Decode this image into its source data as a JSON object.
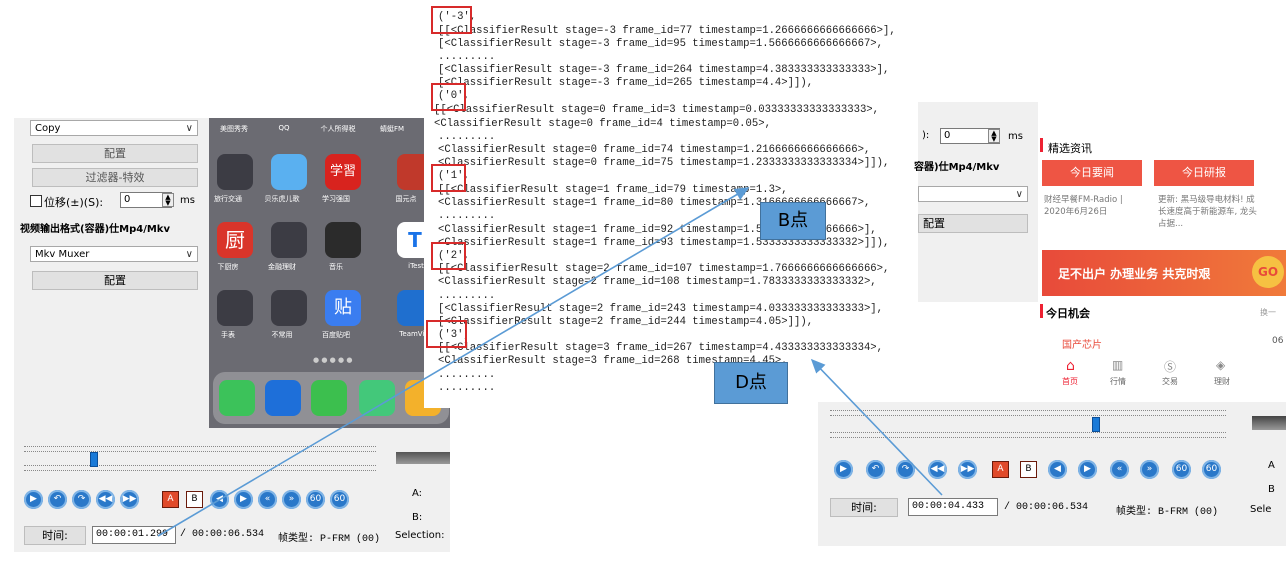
{
  "left_editor": {
    "mode_select": "Copy",
    "config_label": "配置",
    "filter_label": "过滤器-特效",
    "shift_label": "位移(±)(S):",
    "shift_value": "0",
    "shift_unit": "ms",
    "output_format_heading": "视频输出格式(容器)仕Mp4/Mkv",
    "muxer_select": "Mkv Muxer",
    "config2_label": "配置",
    "time_label": "时间:",
    "time_value": "00:00:01.299",
    "duration": "/ 00:00:06.534",
    "frame_type": "帧类型: P-FRM (00)",
    "a_label": "A:",
    "b_label": "B:",
    "selection_label": "Selection:"
  },
  "phone": {
    "top_labels": [
      "美图秀秀",
      "QQ",
      "个人所得税",
      "蜻蜓FM"
    ],
    "row1_labels": [
      "旅行交通",
      "贝乐虎儿歌",
      "学习强国",
      "国元点"
    ],
    "row2_labels": [
      "下厨房",
      "金融理财",
      "音乐",
      "iTest"
    ],
    "row3_labels": [
      "手表",
      "不常用",
      "百度贴吧",
      "TeamVie"
    ],
    "app_glyphs": {
      "xuexi": "学習",
      "xiachufang": "厨",
      "tieba": "贴",
      "itest": "T"
    }
  },
  "log": {
    "lines": [
      "('-3',",
      "[[<ClassifierResult stage=-3 frame_id=77 timestamp=1.2666666666666666>],",
      "[<ClassifierResult stage=-3 frame_id=95 timestamp=1.5666666666666667>,",
      ".........",
      "[<ClassifierResult stage=-3 frame_id=264 timestamp=4.383333333333333>],",
      "[<ClassifierResult stage=-3 frame_id=265 timestamp=4.4>]]),",
      "('0',",
      "[[<ClassifierResult stage=0 frame_id=3 timestamp=0.03333333333333333>,",
      "<ClassifierResult stage=0 frame_id=4 timestamp=0.05>,",
      ".........",
      "<ClassifierResult stage=0 frame_id=74 timestamp=1.2166666666666666>,",
      "<ClassifierResult stage=0 frame_id=75 timestamp=1.2333333333333334>]]),",
      "('1',",
      "[[<ClassifierResult stage=1 frame_id=79 timestamp=1.3>,",
      "<ClassifierResult stage=1 frame_id=80 timestamp=1.3166666666666667>,",
      ".........",
      "<ClassifierResult stage=1 frame_id=92 timestamp=1.5166666666666666>],",
      "<ClassifierResult stage=1 frame_id=93 timestamp=1.5333333333333332>]]),",
      "('2',",
      "[[<ClassifierResult stage=2 frame_id=107 timestamp=1.7666666666666666>,",
      "<ClassifierResult stage=2 frame_id=108 timestamp=1.7833333333333332>,",
      ".........",
      "[<ClassifierResult stage=2 frame_id=243 timestamp=4.033333333333333>],",
      "[<ClassifierResult stage=2 frame_id=244 timestamp=4.05>]]),",
      "('3',",
      "[[<ClassifierResult stage=3 frame_id=267 timestamp=4.433333333333334>,",
      "<ClassifierResult stage=3 frame_id=268 timestamp=4.45>,",
      ".........",
      "........."
    ]
  },
  "callouts": {
    "b": "B点",
    "d": "D点"
  },
  "right_app": {
    "shift_partial": "):",
    "shift_value": "0",
    "shift_unit": "ms",
    "format_partial": "容器)仕Mp4/Mkv",
    "config_label": "配置",
    "news_title": "精选资讯",
    "tab_today": "今日要闻",
    "tab_research": "今日研报",
    "news1": "财经早餐FM-Radio | 2020年6月26日",
    "news2": "更新: 黑马级导电材料! 成长速度高于新能源车, 龙头占据...",
    "banner": "足不出户 办理业务 共克时艰",
    "banner_go": "GO",
    "opportunity_title": "今日机会",
    "opportunity_more": "换一",
    "chip_label": "国产芯片",
    "chip_value": "06",
    "nav": [
      "首页",
      "行情",
      "交易",
      "理财"
    ]
  },
  "right_editor": {
    "time_label": "时间:",
    "time_value": "00:00:04.433",
    "duration": "/ 00:00:06.534",
    "frame_type": "帧类型: B-FRM (00)",
    "a_label": "A",
    "b_label": "B",
    "selection_label": "Sele"
  },
  "colors": {
    "accent_blue": "#5b9bd5",
    "red_box": "#d72a2a",
    "tab_red": "#ee5544"
  }
}
